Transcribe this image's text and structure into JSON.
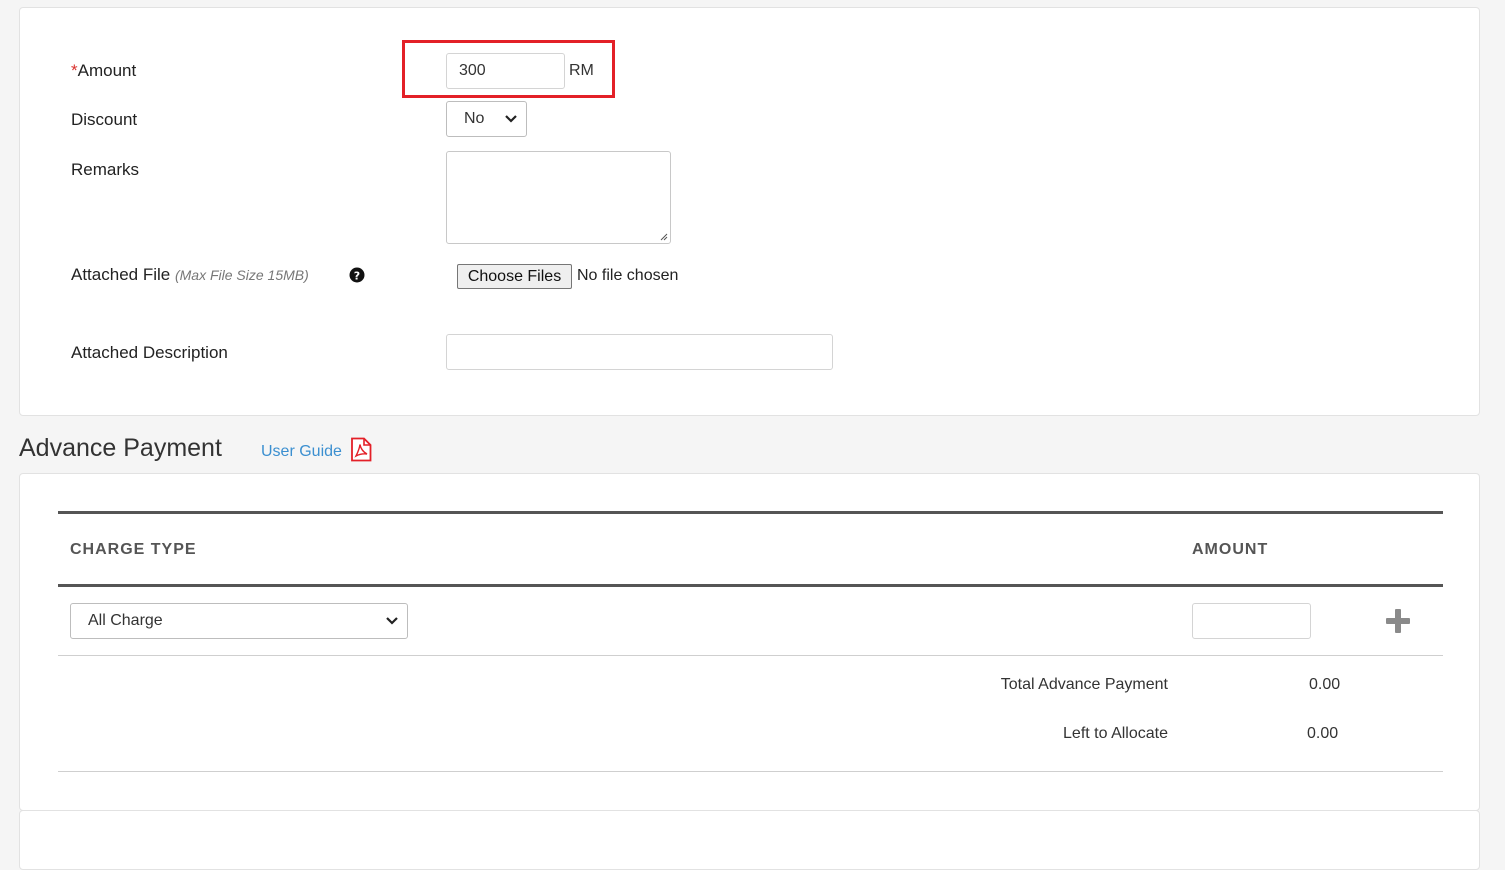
{
  "form": {
    "amount": {
      "required_mark": "*",
      "label": "Amount",
      "value": "300",
      "unit": "RM"
    },
    "discount": {
      "label": "Discount",
      "selected": "No"
    },
    "remarks": {
      "label": "Remarks",
      "value": ""
    },
    "attached_file": {
      "label": "Attached File",
      "note": "(Max File Size 15MB)",
      "help_icon": "question-circle-icon",
      "button_label": "Choose Files",
      "status": "No file chosen"
    },
    "attached_description": {
      "label": "Attached Description",
      "value": ""
    }
  },
  "highlight": {
    "color": "#e32028"
  },
  "advance_payment": {
    "title": "Advance Payment",
    "user_guide_label": "User Guide",
    "user_guide_icon": "pdf-file-icon",
    "columns": {
      "charge_type": "CHARGE TYPE",
      "amount": "AMOUNT"
    },
    "row": {
      "charge_type_selected": "All Charge",
      "amount_value": "",
      "add_icon": "plus-icon"
    },
    "summary": {
      "total_label": "Total Advance Payment",
      "total_value": "0.00",
      "left_label": "Left to Allocate",
      "left_value": "0.00"
    }
  },
  "colors": {
    "link": "#3b8fd0",
    "required": "#d9302c",
    "pdf_icon": "#e32028"
  }
}
